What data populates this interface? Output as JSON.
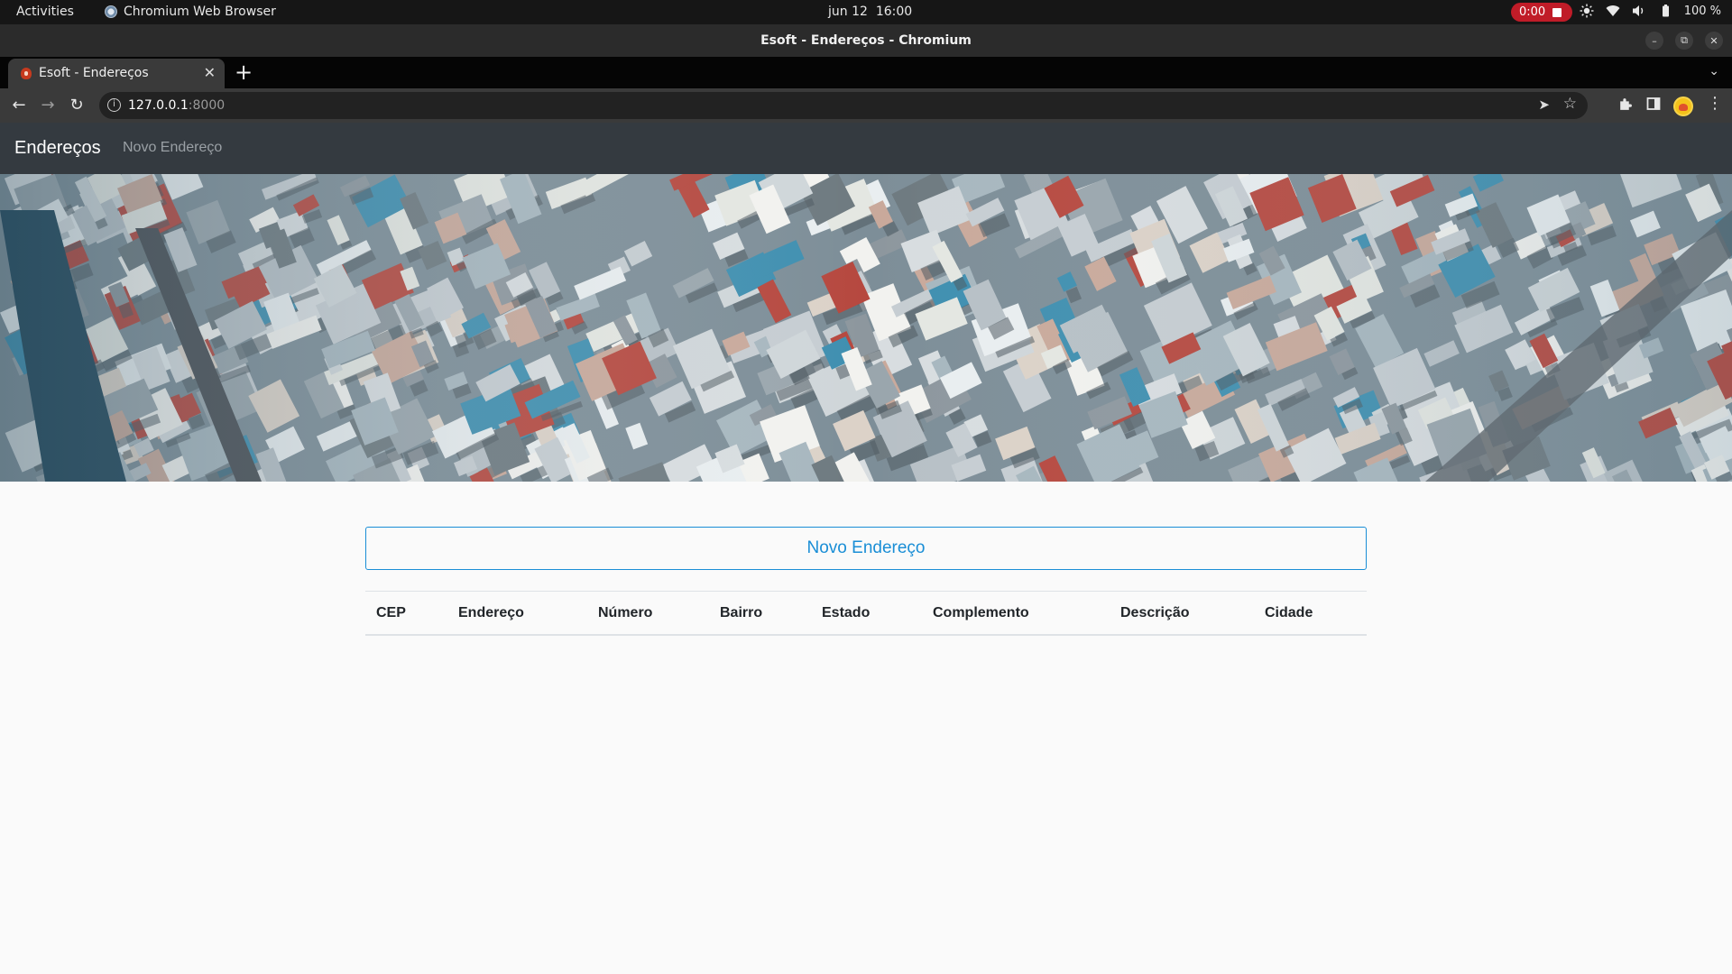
{
  "system_bar": {
    "activities": "Activities",
    "app_name": "Chromium Web Browser",
    "date": "jun 12",
    "time": "16:00",
    "recording_time": "0:00",
    "battery": "100 %"
  },
  "window": {
    "title": "Esoft - Endereços - Chromium"
  },
  "tabs": [
    {
      "label": "Esoft - Endereços"
    }
  ],
  "address_bar": {
    "host": "127.0.0.1",
    "port": ":8000"
  },
  "navbar": {
    "brand": "Endereços",
    "link": "Novo Endereço"
  },
  "main": {
    "new_address_button": "Novo Endereço",
    "table": {
      "columns": [
        "CEP",
        "Endereço",
        "Número",
        "Bairro",
        "Estado",
        "Complemento",
        "Descrição",
        "Cidade"
      ],
      "rows": []
    }
  },
  "colors": {
    "navbar_bg": "#343a40",
    "accent": "#1a8ed6",
    "recording": "#c01c28"
  }
}
